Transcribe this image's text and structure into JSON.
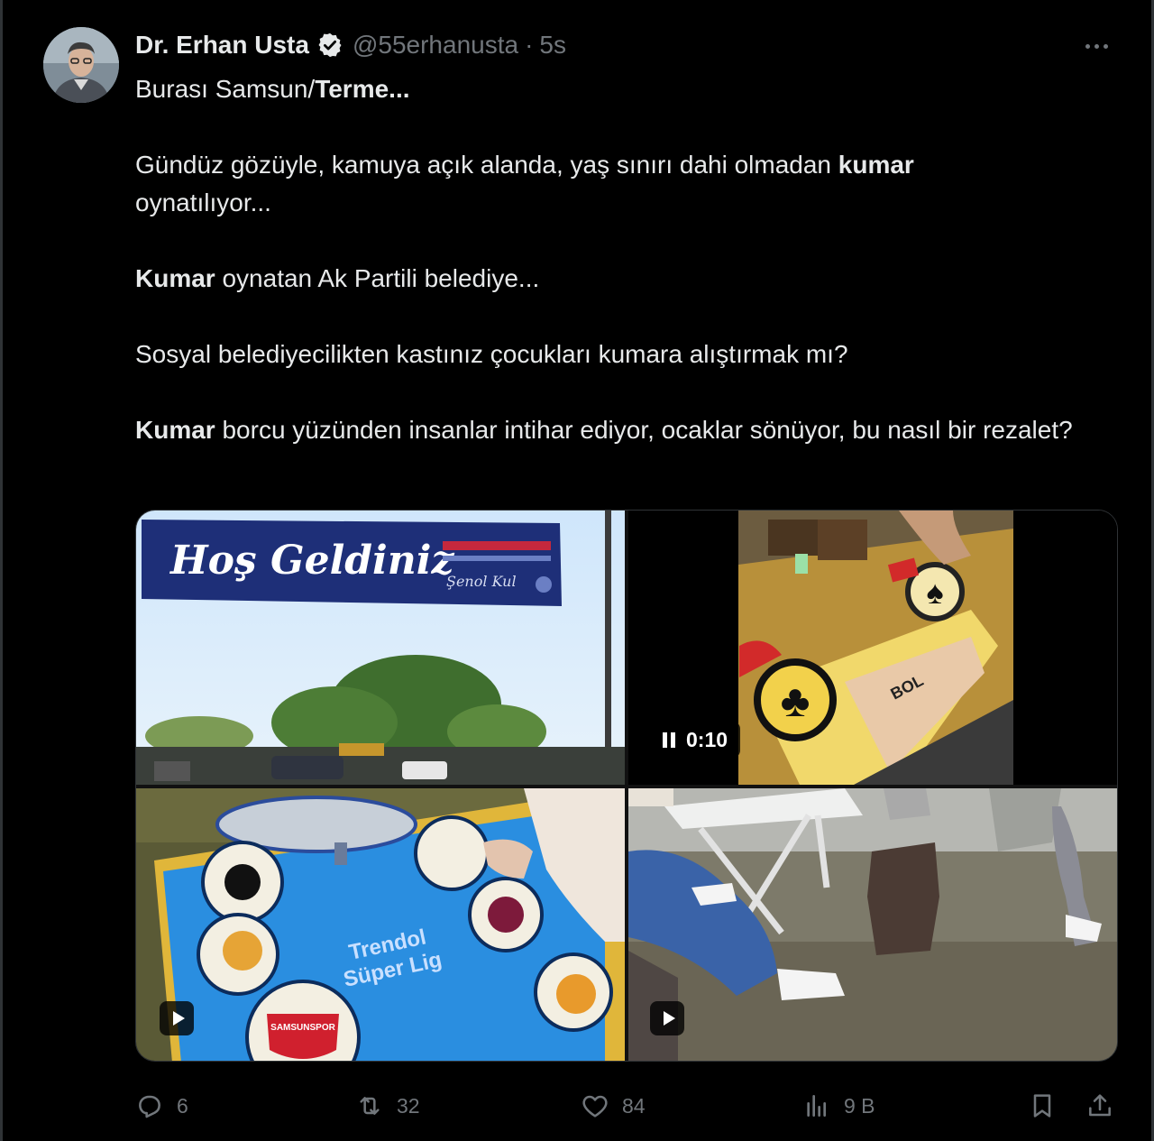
{
  "author": {
    "name": "Dr. Erhan Usta",
    "handle": "@55erhanusta",
    "separator": "·",
    "time": "5s",
    "verified": true,
    "verified_color": "#e7e9ea"
  },
  "tweet": {
    "p1_a": "Burası Samsun/",
    "p1_b": "Terme...",
    "p2_a": "Gündüz gözüyle, kamuya açık alanda, yaş sınırı dahi olmadan ",
    "p2_b": "kumar",
    "p2_c": "oynatılıyor...",
    "p3_a": "Kumar",
    "p3_b": " oynatan Ak Partili belediye...",
    "p4": "Sosyal belediyecilikten kastınız çocukları kumara alıştırmak mı?",
    "p5_a": "Kumar",
    "p5_b": " borcu yüzünden insanlar intihar ediyor, ocaklar sönüyor, bu nasıl bir rezalet?"
  },
  "media": {
    "banner_text": "Hoş Geldiniz",
    "banner_sign": "Şenol Kul",
    "video_duration": "0:10",
    "board_text_1": "Trendol",
    "board_text_2": "Süper Lig",
    "card_text": "BOL",
    "logo_text": "SAMSUNSPOR"
  },
  "actions": {
    "replies": "6",
    "reposts": "32",
    "likes": "84",
    "views": "9 B"
  },
  "icons": {
    "more": "more-dots-icon",
    "verified": "verified-badge-icon",
    "reply": "reply-icon",
    "repost": "repost-icon",
    "like": "heart-icon",
    "views": "views-chart-icon",
    "bookmark": "bookmark-icon",
    "share": "share-icon",
    "play": "play-icon",
    "pause": "pause-icon"
  },
  "colors": {
    "background": "#000000",
    "text": "#e7e9ea",
    "muted": "#71767b",
    "border": "#2f3336"
  }
}
